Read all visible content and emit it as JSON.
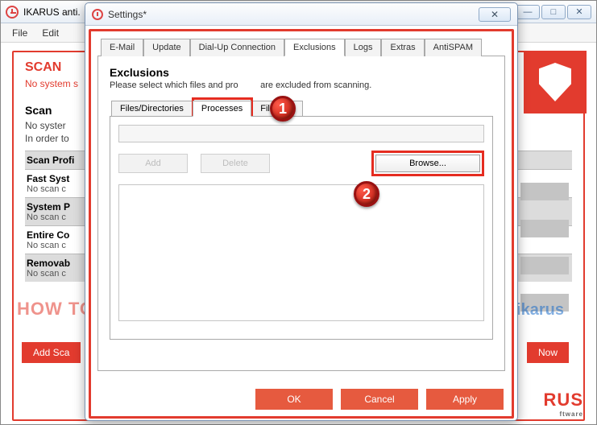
{
  "bg": {
    "title": "IKARUS anti.",
    "menus": [
      "File",
      "Edit"
    ],
    "winctrls": {
      "min": "—",
      "max": "□",
      "close": "✕"
    },
    "scan_heading": "SCAN",
    "scan_sub": "No system s",
    "section_heading": "Scan",
    "lines": [
      "No syster",
      "In order to"
    ],
    "rows": [
      {
        "title": "Scan Profi",
        "sub": "",
        "shade": true
      },
      {
        "title": "Fast Syst",
        "sub": "No scan c"
      },
      {
        "title": "System P",
        "sub": "No scan c",
        "shade": true
      },
      {
        "title": "Entire Co",
        "sub": "No scan c"
      },
      {
        "title": "Removab",
        "sub": "No scan c",
        "shade": true
      }
    ],
    "add_btn": "Add Sca",
    "right_btn": "Now",
    "logo": "RUS",
    "logo_sub": "ftware"
  },
  "watermark": "HOW TO WHITELIST SOFTWARE IN IKARUS",
  "watermark2": "nbots.me/sikarus",
  "modal": {
    "title": "Settings*",
    "close": "✕",
    "tabs": [
      "E-Mail",
      "Update",
      "Dial-Up Connection",
      "Exclusions",
      "Logs",
      "Extras",
      "AntiSPAM"
    ],
    "active_tab": 3,
    "excl_heading": "Exclusions",
    "excl_sub_before": "Please select which files and pro",
    "excl_sub_after": "are excluded from scanning.",
    "subtabs": [
      "Files/Directories",
      "Processes",
      "File Size"
    ],
    "active_subtab": 1,
    "add_btn": "Add",
    "del_btn": "Delete",
    "browse_btn": "Browse...",
    "ok": "OK",
    "cancel": "Cancel",
    "apply": "Apply"
  },
  "markers": {
    "one": "1",
    "two": "2"
  }
}
